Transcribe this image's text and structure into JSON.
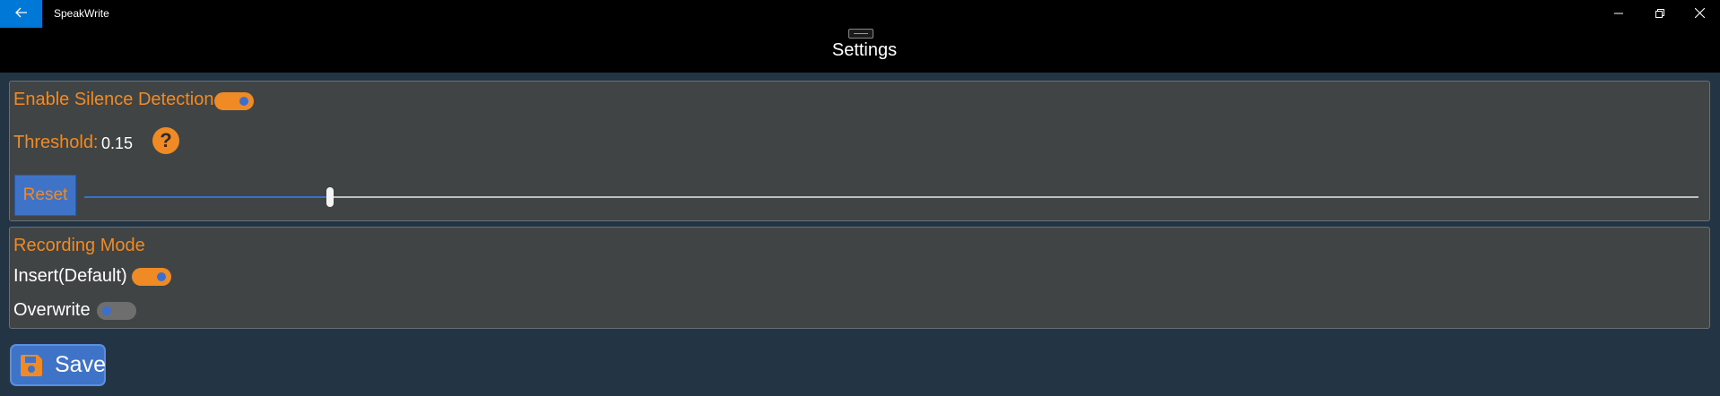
{
  "window": {
    "app_title": "SpeakWrite",
    "page_title": "Settings",
    "back_icon": "arrow-left-icon",
    "minimize_icon": "minimize-icon",
    "restore_icon": "restore-icon",
    "close_icon": "close-icon"
  },
  "silence": {
    "enable_label": "Enable Silence Detection",
    "enable_on": true,
    "threshold_label": "Threshold:",
    "threshold_value": "0.15",
    "help_icon": "question-mark-icon",
    "help_glyph": "?",
    "reset_label": "Reset",
    "slider_fraction": 0.152
  },
  "recording": {
    "heading": "Recording Mode",
    "insert_label": "Insert(Default)",
    "insert_on": true,
    "overwrite_label": "Overwrite",
    "overwrite_on": false
  },
  "save": {
    "label": "Save",
    "icon": "floppy-disk-icon"
  },
  "colors": {
    "accent_orange": "#f08a24",
    "button_blue": "#3f73c8",
    "panel_bg": "#404444",
    "page_bg": "#233445"
  }
}
